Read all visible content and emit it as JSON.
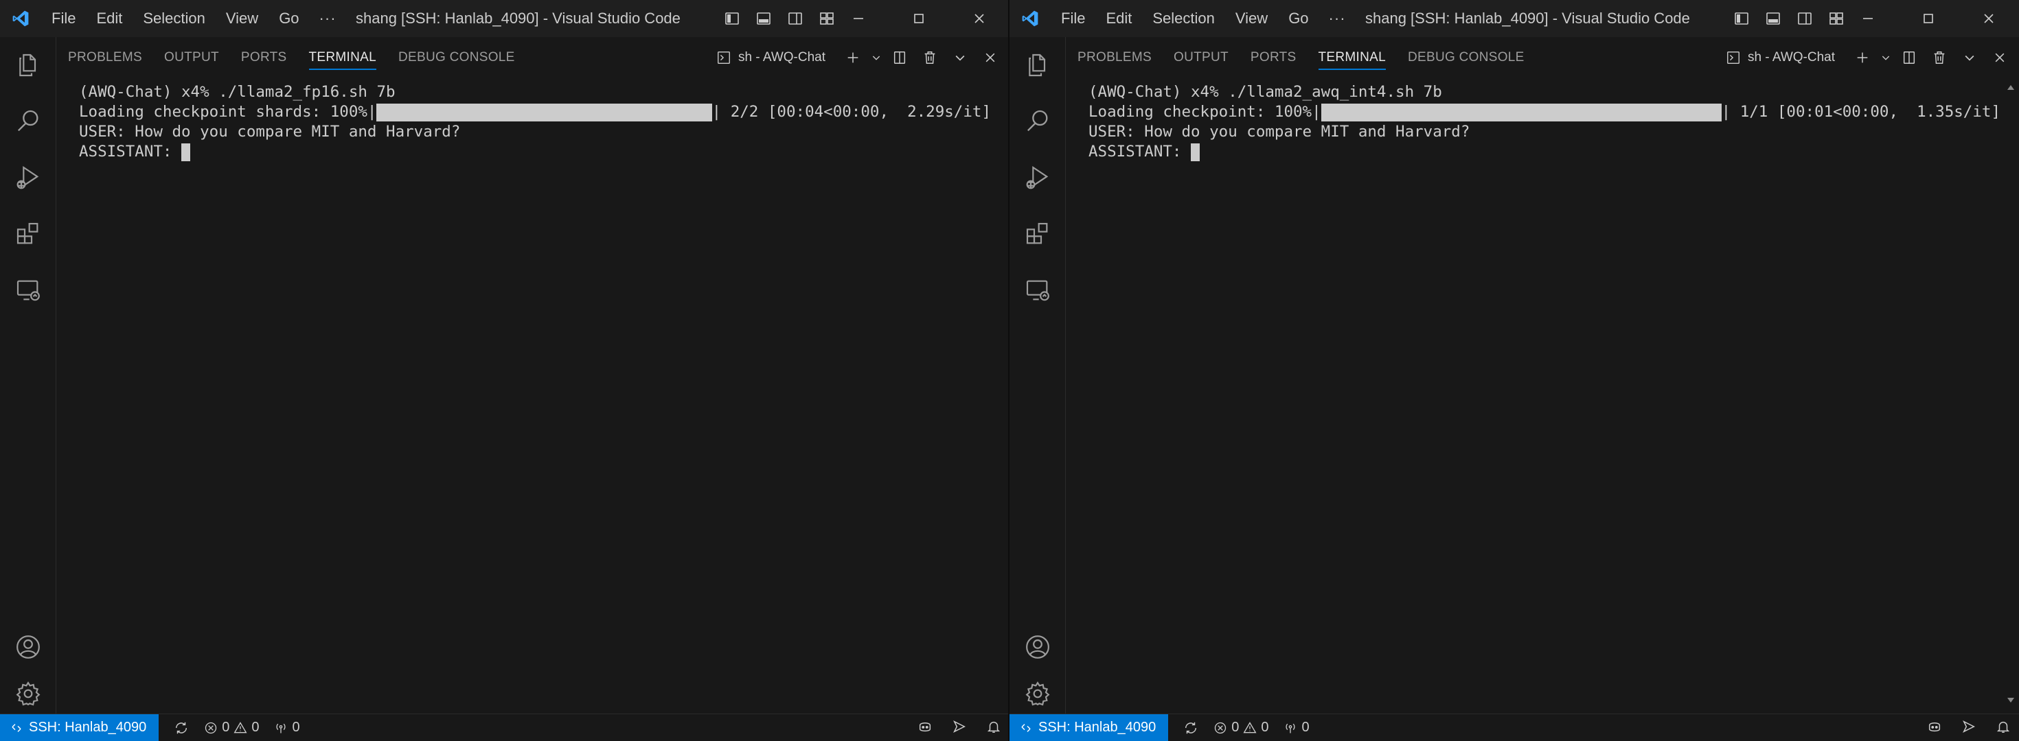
{
  "windows": [
    {
      "menu": [
        "File",
        "Edit",
        "Selection",
        "View",
        "Go"
      ],
      "menu_more": "···",
      "title": "shang [SSH: Hanlab_4090] - Visual Studio Code",
      "panel": {
        "tabs": [
          "PROBLEMS",
          "OUTPUT",
          "PORTS",
          "TERMINAL",
          "DEBUG CONSOLE"
        ],
        "active_tab": "TERMINAL",
        "terminal_name": "sh - AWQ-Chat"
      },
      "terminal": {
        "line1": "(AWQ-Chat) x4% ./llama2_fp16.sh 7b",
        "progress_prefix": "Loading checkpoint shards: 100%|",
        "progress_suffix": "| 2/2 [00:04<00:00,  2.29s/it]",
        "progress_fraction": 1.0,
        "user_line": "USER: How do you compare MIT and Harvard?",
        "assistant_prefix": "ASSISTANT: "
      },
      "status": {
        "remote": "SSH: Hanlab_4090",
        "errors": "0",
        "warnings": "0",
        "ports": "0"
      }
    },
    {
      "menu": [
        "File",
        "Edit",
        "Selection",
        "View",
        "Go"
      ],
      "menu_more": "···",
      "title": "shang [SSH: Hanlab_4090] - Visual Studio Code",
      "panel": {
        "tabs": [
          "PROBLEMS",
          "OUTPUT",
          "PORTS",
          "TERMINAL",
          "DEBUG CONSOLE"
        ],
        "active_tab": "TERMINAL",
        "terminal_name": "sh - AWQ-Chat"
      },
      "terminal": {
        "line1": "(AWQ-Chat) x4% ./llama2_awq_int4.sh 7b",
        "progress_prefix": "Loading checkpoint: 100%|",
        "progress_suffix": "| 1/1 [00:01<00:00,  1.35s/it]",
        "progress_fraction": 1.0,
        "user_line": "USER: How do you compare MIT and Harvard?",
        "assistant_prefix": "ASSISTANT: "
      },
      "status": {
        "remote": "SSH: Hanlab_4090",
        "errors": "0",
        "warnings": "0",
        "ports": "0"
      }
    }
  ],
  "colors": {
    "accent": "#0078d4",
    "vscode_blue": "#3ea6ff",
    "icon": "#cccccc"
  },
  "icons": [
    "vscode-logo-icon",
    "explorer-icon",
    "search-icon",
    "run-debug-icon",
    "extensions-icon",
    "remote-explorer-icon",
    "account-icon",
    "settings-gear-icon"
  ]
}
